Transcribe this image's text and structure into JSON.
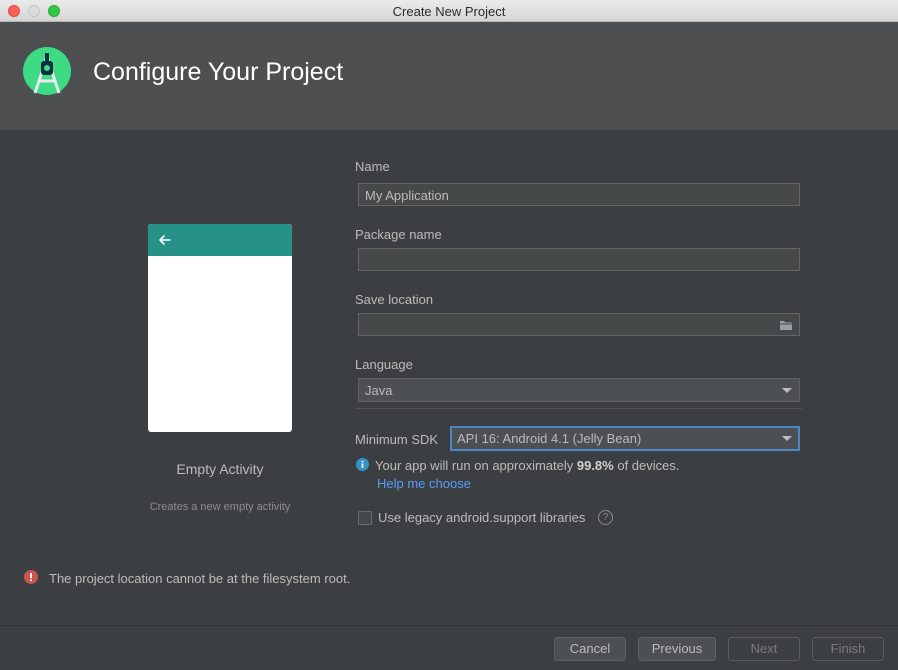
{
  "window": {
    "title": "Create New Project"
  },
  "header": {
    "title": "Configure Your Project"
  },
  "template": {
    "name": "Empty Activity",
    "description": "Creates a new empty activity"
  },
  "form": {
    "name_label": "Name",
    "name_value": "My Application",
    "package_label": "Package name",
    "package_value": "",
    "save_label": "Save location",
    "save_value": "",
    "language_label": "Language",
    "language_value": "Java",
    "min_sdk_label": "Minimum SDK",
    "min_sdk_value": "API 16: Android 4.1 (Jelly Bean)",
    "info_prefix": "Your app will run on approximately ",
    "info_percent": "99.8%",
    "info_suffix": " of devices.",
    "help_link": "Help me choose",
    "legacy_label": "Use legacy android.support libraries",
    "legacy_checked": false
  },
  "error": {
    "message": "The project location cannot be at the filesystem root."
  },
  "buttons": {
    "cancel": "Cancel",
    "previous": "Previous",
    "next": "Next",
    "finish": "Finish"
  },
  "colors": {
    "accent": "#269287",
    "link": "#589df6",
    "error": "#c75450",
    "info": "#3592c4"
  },
  "icons": [
    "android-studio-logo-icon",
    "back-arrow-icon",
    "folder-icon",
    "info-icon",
    "help-question-icon",
    "error-icon"
  ]
}
